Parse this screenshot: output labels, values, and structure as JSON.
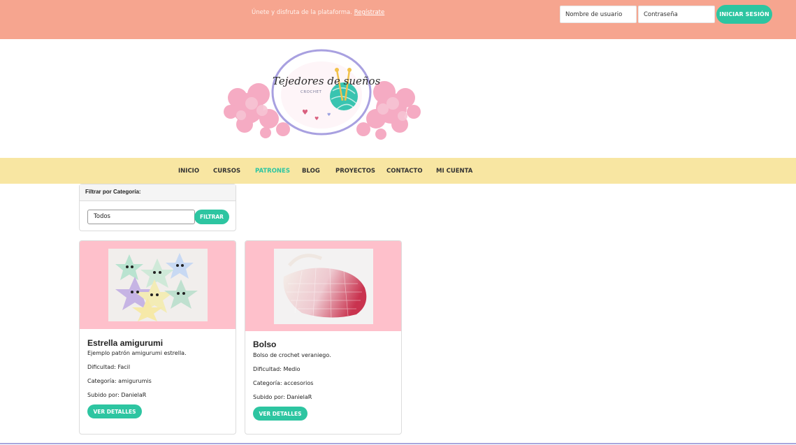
{
  "topbar": {
    "message": "Únete y disfruta de la plataforma.",
    "register_link": "Regístrate",
    "username_placeholder": "Nombre de usuario",
    "password_placeholder": "Contraseña",
    "login_button": "INICIAR SESIÓN"
  },
  "logo": {
    "title": "Tejedores de sueños",
    "subtitle": "CROCHET"
  },
  "nav": {
    "items": [
      {
        "label": "INICIO"
      },
      {
        "label": "CURSOS"
      },
      {
        "label": "PATRONES"
      },
      {
        "label": "BLOG"
      },
      {
        "label": "PROYECTOS"
      },
      {
        "label": "CONTACTO"
      },
      {
        "label": "MI CUENTA"
      }
    ],
    "active": "PATRONES"
  },
  "filter": {
    "heading": "Filtrar por Categoría:",
    "selected": "Todos",
    "button": "FILTRAR"
  },
  "cards": [
    {
      "title": "Estrella amigurumi",
      "description": "Ejemplo patrón amigurumi estrella.",
      "difficulty": "Dificultad: Facil",
      "category": "Categoría: amigurumis",
      "uploaded_by": "Subido por: DanielaR",
      "button": "VER DETALLES"
    },
    {
      "title": "Bolso",
      "description": "Bolso de crochet veraniego.",
      "difficulty": "Dificultad: Medio",
      "category": "Categoría: accesorios",
      "uploaded_by": "Subido por: DanielaR",
      "button": "VER DETALLES"
    }
  ],
  "colors": {
    "topbar": "#f6a58f",
    "nav": "#f8e6a2",
    "accent": "#2dc5a1",
    "card_image_bg": "#fec0cb"
  }
}
